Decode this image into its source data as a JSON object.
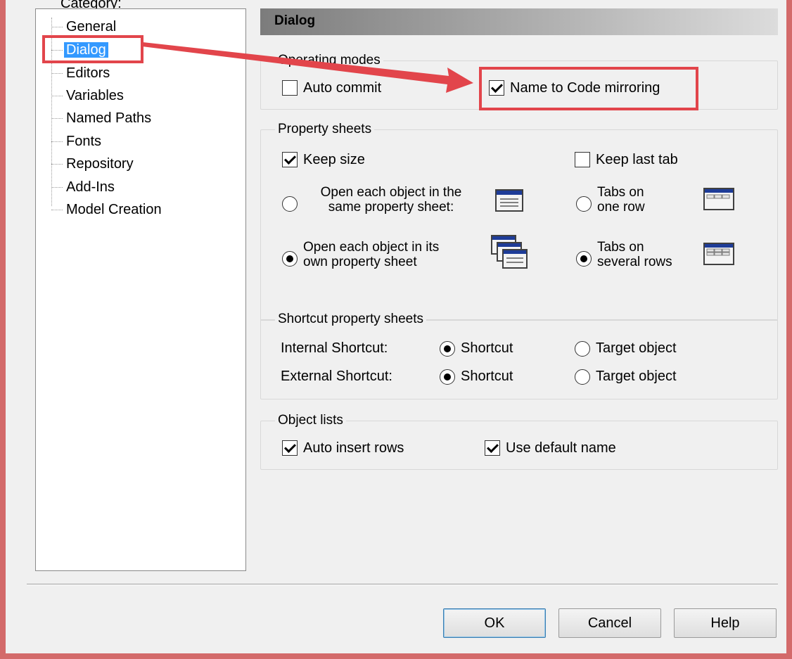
{
  "window": {
    "category_label": "Category:"
  },
  "tree": {
    "items": [
      {
        "label": "General"
      },
      {
        "label": "Dialog",
        "selected": true
      },
      {
        "label": "Editors"
      },
      {
        "label": "Variables"
      },
      {
        "label": "Named Paths"
      },
      {
        "label": "Fonts"
      },
      {
        "label": "Repository"
      },
      {
        "label": "Add-Ins"
      },
      {
        "label": "Model Creation"
      }
    ]
  },
  "panel": {
    "title": "Dialog"
  },
  "operating_modes": {
    "legend": "Operating modes",
    "auto_commit": {
      "label": "Auto commit",
      "checked": false
    },
    "name_code_mirroring": {
      "label": "Name to Code mirroring",
      "checked": true
    }
  },
  "property_sheets": {
    "legend": "Property sheets",
    "keep_size": {
      "label": "Keep size",
      "checked": true
    },
    "keep_last_tab": {
      "label": "Keep last tab",
      "checked": false
    },
    "open_same": {
      "line1": "Open each object in the",
      "line2": "same property sheet:",
      "selected": false
    },
    "open_own": {
      "line1": "Open each object in its",
      "line2": "own property sheet",
      "selected": true
    },
    "tabs_one_row": {
      "line1": "Tabs on",
      "line2": "one row",
      "selected": false
    },
    "tabs_several_rows": {
      "line1": "Tabs on",
      "line2": "several rows",
      "selected": true
    }
  },
  "shortcut_sheets": {
    "legend": "Shortcut property sheets",
    "internal": {
      "label": "Internal Shortcut:",
      "option_shortcut": "Shortcut",
      "option_target": "Target object",
      "selected": "Shortcut"
    },
    "external": {
      "label": "External Shortcut:",
      "option_shortcut": "Shortcut",
      "option_target": "Target object",
      "selected": "Shortcut"
    }
  },
  "object_lists": {
    "legend": "Object lists",
    "auto_insert_rows": {
      "label": "Auto insert rows",
      "checked": true
    },
    "use_default_name": {
      "label": "Use default name",
      "checked": true
    }
  },
  "buttons": {
    "ok": "OK",
    "cancel": "Cancel",
    "help": "Help"
  },
  "colors": {
    "annotation": "#e2454b",
    "selection": "#3399ff",
    "window_border": "#d36a6a"
  }
}
